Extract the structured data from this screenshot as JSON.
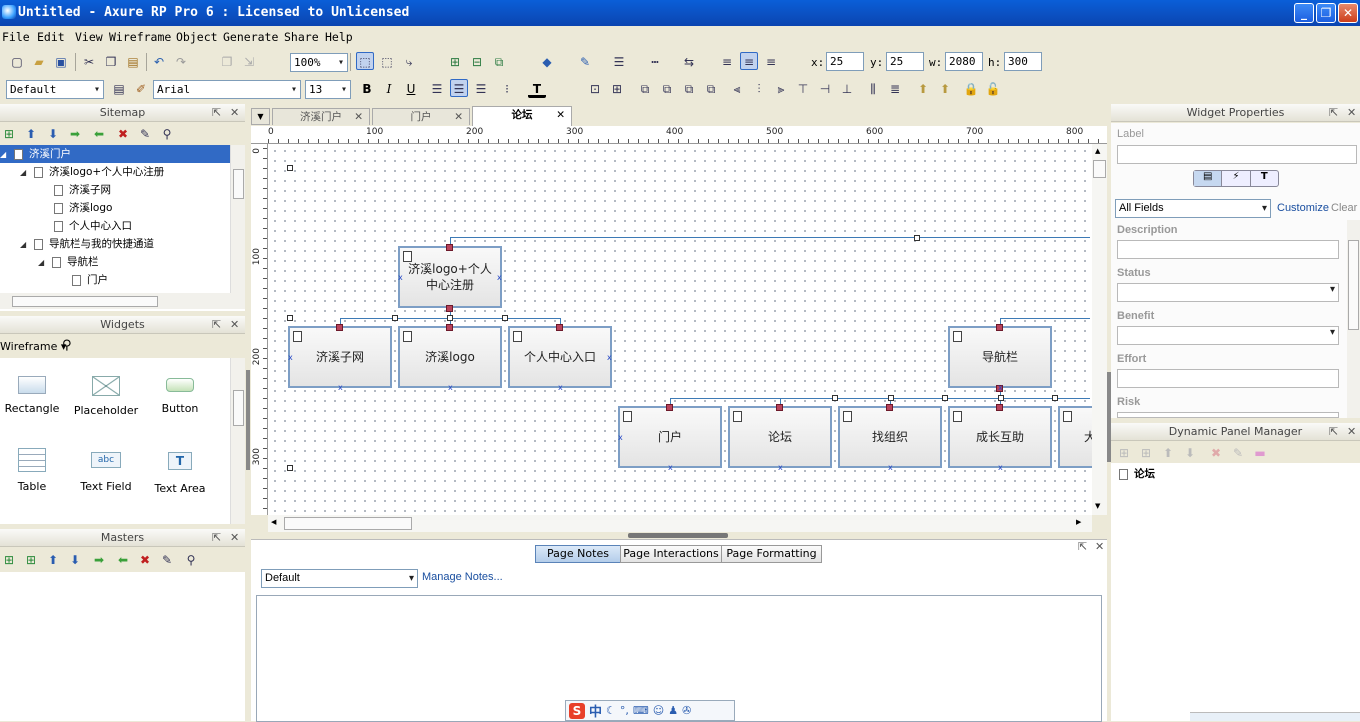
{
  "title": "Untitled - Axure RP Pro 6 : Licensed to Unlicensed",
  "menu": [
    "File",
    "Edit",
    "View",
    "Wireframe",
    "Object",
    "Generate",
    "Share",
    "Help"
  ],
  "toolbar": {
    "zoom": "100%",
    "x_label": "x:",
    "x": "25",
    "y_label": "y:",
    "y": "25",
    "w_label": "w:",
    "w": "2080",
    "h_label": "h:",
    "h": "300",
    "style": "Default",
    "font": "Arial",
    "font_size": "13",
    "bold": "B",
    "italic": "I",
    "underline": "U",
    "text_color": "T"
  },
  "sitemap": {
    "title": "Sitemap",
    "items": [
      "济溪门户",
      "济溪logo+个人中心注册",
      "济溪子网",
      "济溪logo",
      "个人中心入口",
      "导航栏与我的快捷通道",
      "导航栏",
      "门户"
    ]
  },
  "widgets": {
    "title": "Widgets",
    "library": "Wireframe",
    "items": [
      "Rectangle",
      "Placeholder",
      "Button",
      "Table",
      "Text Field",
      "Text Area"
    ]
  },
  "masters": {
    "title": "Masters"
  },
  "tabs": [
    "济溪门户",
    "门户",
    "论坛"
  ],
  "ruler": {
    "h": [
      "0",
      "100",
      "200",
      "300",
      "400",
      "500",
      "600",
      "700",
      "800"
    ],
    "v": [
      "0",
      "100",
      "200",
      "300"
    ]
  },
  "canvas": {
    "boxes": [
      "济溪logo+个人中心注册",
      "济溪子网",
      "济溪logo",
      "个人中心入口",
      "导航栏",
      "门户",
      "论坛",
      "找组织",
      "成长互助",
      "大"
    ]
  },
  "notes": {
    "tabs": [
      "Page Notes",
      "Page Interactions",
      "Page Formatting"
    ],
    "select": "Default",
    "manage": "Manage Notes..."
  },
  "props": {
    "title": "Widget Properties",
    "label": "Label",
    "fields_select": "All Fields",
    "customize": "Customize",
    "clear": "Clear",
    "fields": [
      "Description",
      "Status",
      "Benefit",
      "Effort",
      "Risk"
    ],
    "tab_text": "T"
  },
  "dpm": {
    "title": "Dynamic Panel Manager",
    "item": "论坛"
  },
  "ime": {
    "s": "S",
    "zh": "中"
  },
  "colors": {
    "title_bar": "#0b4fc0",
    "selection": "#316ac5",
    "handle": "#b8435b",
    "connector": "#3d7ab5"
  }
}
